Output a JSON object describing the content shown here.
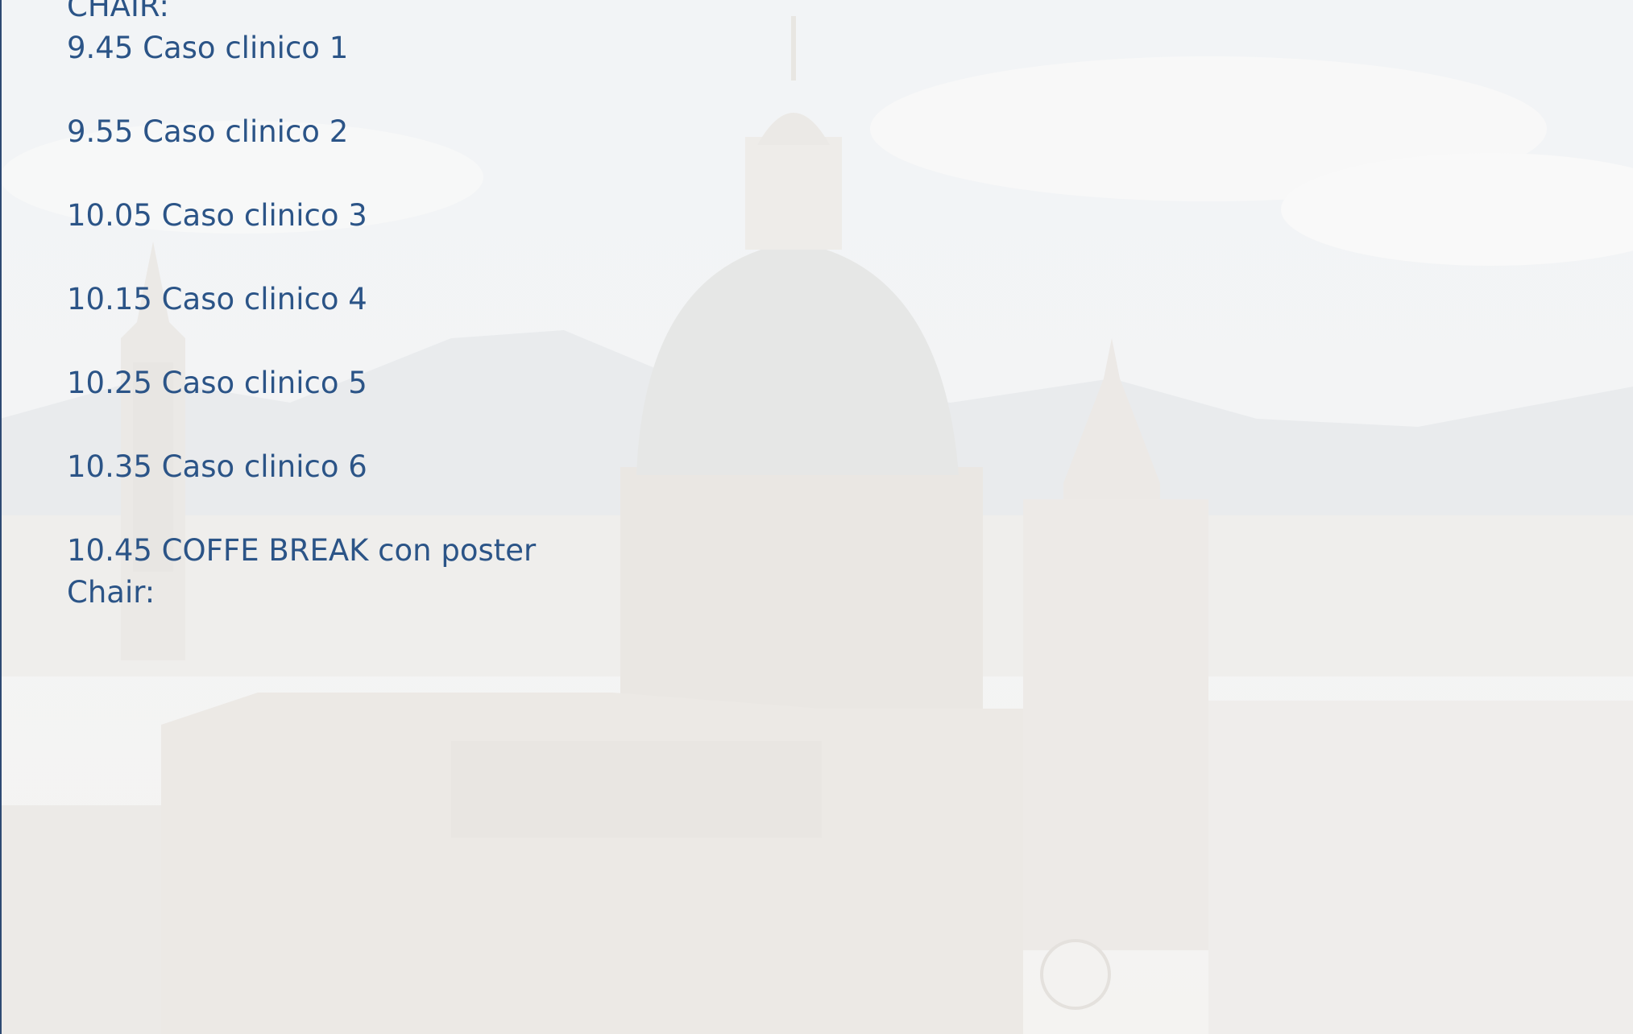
{
  "program": {
    "heading": "CHAIR:",
    "items": [
      "9.45 Caso clinico 1",
      "9.55 Caso clinico 2",
      "10.05 Caso clinico 3",
      "10.15 Caso clinico 4",
      "10.25 Caso clinico 5",
      "10.35 Caso clinico 6",
      "10.45 COFFE BREAK con poster"
    ],
    "chair_label": "Chair:"
  },
  "background": {
    "description_icon": "cathedral-background-image",
    "tint": "#f4f4f3",
    "text_color": "#2b5487"
  }
}
